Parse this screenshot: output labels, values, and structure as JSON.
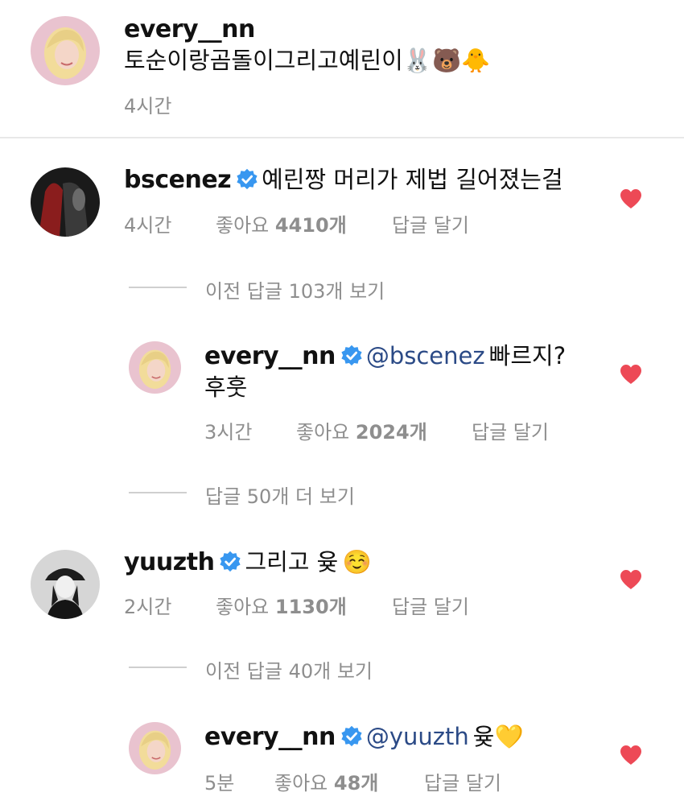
{
  "caption": {
    "username": "every__nn",
    "text": "토순이랑곰돌이그리고예린이",
    "emojis": "🐰🐻🐥",
    "time": "4시간"
  },
  "comments": [
    {
      "username": "bscenez",
      "verified": true,
      "text": "예린짱 머리가 제법 길어졌는걸",
      "time": "4시간",
      "likes_label": "좋아요",
      "likes": "4410개",
      "reply_label": "답글 달기",
      "view_replies": "이전 답글 103개 보기",
      "liked": true
    },
    {
      "username": "every__nn",
      "verified": true,
      "mention": "@bscenez",
      "text_line1": "빠르지?",
      "text_line2": "후훗",
      "time": "3시간",
      "likes_label": "좋아요",
      "likes": "2024개",
      "reply_label": "답글 달기",
      "view_replies": "답글 50개 더 보기",
      "liked": true
    },
    {
      "username": "yuuzth",
      "verified": true,
      "text": "그리고 윶",
      "emoji": "☺️",
      "time": "2시간",
      "likes_label": "좋아요",
      "likes": "1130개",
      "reply_label": "답글 달기",
      "view_replies": "이전 답글 40개 보기",
      "liked": true
    },
    {
      "username": "every__nn",
      "verified": true,
      "mention": "@yuuzth",
      "text": "윶",
      "emoji": "💛",
      "time": "5분",
      "likes_label": "좋아요",
      "likes": "48개",
      "reply_label": "답글 달기",
      "liked": true
    }
  ],
  "colors": {
    "heart": "#ed4956",
    "verified": "#3897f0",
    "mention": "#2b4a86",
    "meta": "#8e8e8e"
  },
  "icons": {
    "heart": "heart-icon",
    "verified": "verified-badge-icon"
  }
}
